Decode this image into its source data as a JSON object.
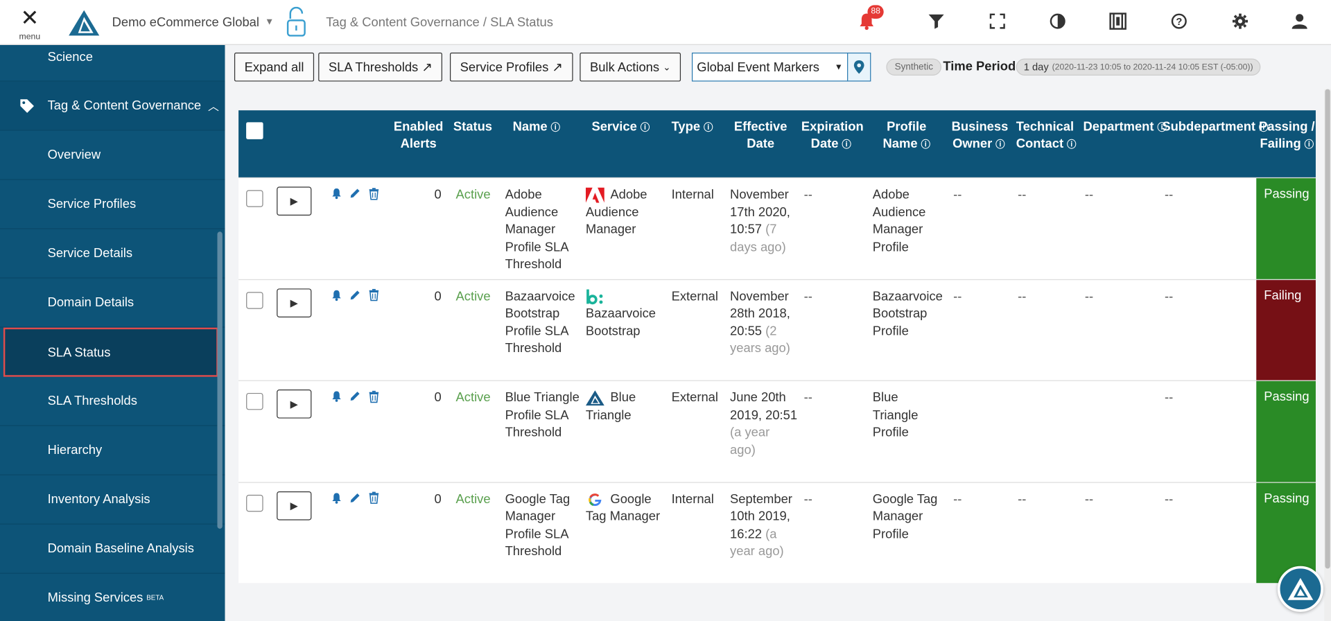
{
  "topbar": {
    "menu_label": "menu",
    "account": "Demo eCommerce Global",
    "breadcrumb": "Tag & Content Governance / SLA Status",
    "notification_count": "88"
  },
  "sidebar": {
    "top_item": "Science",
    "section": "Tag & Content Governance",
    "items": [
      {
        "label": "Overview"
      },
      {
        "label": "Service Profiles"
      },
      {
        "label": "Service Details"
      },
      {
        "label": "Domain Details"
      },
      {
        "label": "SLA Status"
      },
      {
        "label": "SLA Thresholds"
      },
      {
        "label": "Hierarchy"
      },
      {
        "label": "Inventory Analysis"
      },
      {
        "label": "Domain Baseline Analysis"
      },
      {
        "label": "Missing Services"
      }
    ],
    "beta_tag": "BETA"
  },
  "toolbar": {
    "expand_all": "Expand all",
    "sla_thresholds": "SLA Thresholds",
    "service_profiles": "Service Profiles",
    "bulk_actions": "Bulk Actions",
    "event_markers": "Global Event Markers",
    "synthetic": "Synthetic",
    "time_period_label": "Time Period:",
    "time_period_value": "1 day",
    "time_period_range": "(2020-11-23 10:05 to 2020-11-24 10:05 EST (-05:00))"
  },
  "table": {
    "headers": {
      "enabled_alerts": "Enabled Alerts",
      "status": "Status",
      "name": "Name",
      "service": "Service",
      "type": "Type",
      "effective_date": "Effective Date",
      "expiration_date": "Expiration Date",
      "profile_name": "Profile Name",
      "business_owner": "Business Owner",
      "technical_contact": "Technical Contact",
      "department": "Department",
      "subdepartment": "Subdepartment",
      "passing_failing": "Passing / Failing"
    },
    "rows": [
      {
        "alerts": "0",
        "status": "Active",
        "name": "Adobe Audience Manager Profile SLA Threshold",
        "service": "Adobe Audience Manager",
        "service_icon": "adobe-icon",
        "type": "Internal",
        "effective": "November 17th 2020, 10:57",
        "ago": "(7 days ago)",
        "expiration": "--",
        "profile": "Adobe Audience Manager Profile",
        "owner": "--",
        "contact": "--",
        "dept": "--",
        "subdept": "--",
        "result": "Passing"
      },
      {
        "alerts": "0",
        "status": "Active",
        "name": "Bazaarvoice Bootstrap Profile SLA Threshold",
        "service": "Bazaarvoice Bootstrap",
        "service_icon": "bazaarvoice-icon",
        "type": "External",
        "effective": "November 28th 2018, 20:55",
        "ago": "(2 years ago)",
        "expiration": "--",
        "profile": "Bazaarvoice Bootstrap Profile",
        "owner": "--",
        "contact": "--",
        "dept": "--",
        "subdept": "--",
        "result": "Failing"
      },
      {
        "alerts": "0",
        "status": "Active",
        "name": "Blue Triangle Profile SLA Threshold",
        "service": "Blue Triangle",
        "service_icon": "blue-triangle-icon",
        "type": "External",
        "effective": "June 20th 2019, 20:51",
        "ago": "(a year ago)",
        "expiration": "--",
        "profile": "Blue Triangle Profile",
        "owner": "",
        "contact": "",
        "dept": "",
        "subdept": "--",
        "result": "Passing"
      },
      {
        "alerts": "0",
        "status": "Active",
        "name": "Google Tag Manager Profile SLA Threshold",
        "service": "Google Tag Manager",
        "service_icon": "google-icon",
        "type": "Internal",
        "effective": "September 10th 2019, 16:22",
        "ago": "(a year ago)",
        "expiration": "--",
        "profile": "Google Tag Manager Profile",
        "owner": "--",
        "contact": "--",
        "dept": "--",
        "subdept": "--",
        "result": "Passing"
      }
    ]
  },
  "colors": {
    "primary": "#0d5478",
    "passing": "#2a8b26",
    "failing": "#761015",
    "active": "#5aa04e",
    "badge": "#e53935"
  }
}
